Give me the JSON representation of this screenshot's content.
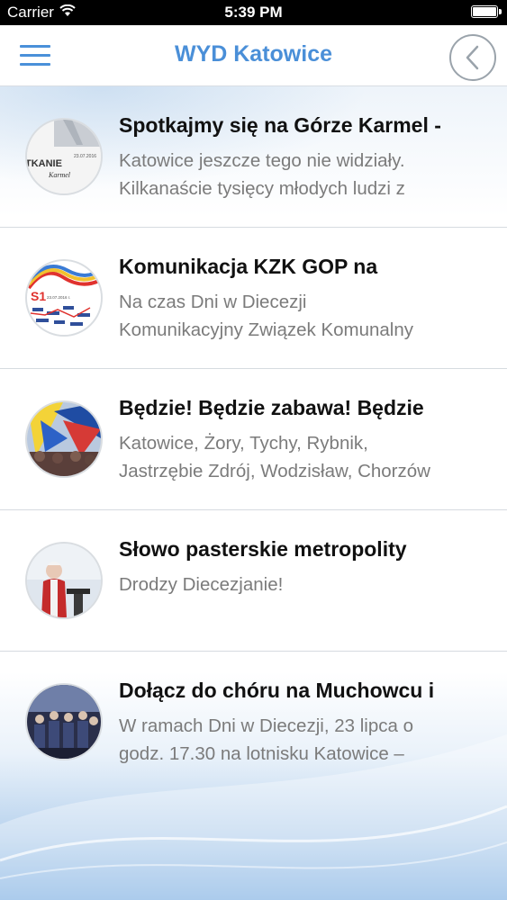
{
  "status_bar": {
    "carrier": "Carrier",
    "time": "5:39 PM"
  },
  "nav": {
    "title": "WYD Katowice"
  },
  "colors": {
    "accent": "#4a8fd8",
    "title_text": "#111111",
    "excerpt_text": "#7b7b7b"
  },
  "news": [
    {
      "title": "Spotkajmy się na Górze Karmel -",
      "excerpt": "Katowice jeszcze tego nie widziały.\nKilkanaście tysięcy młodych ludzi z",
      "thumb_text": "TKANIE",
      "thumb_sub": "Karmel",
      "thumb_date": "23.07.2016"
    },
    {
      "title": "Komunikacja KZK GOP na",
      "excerpt": "Na czas Dni w Diecezji\nKomunikacyjny Związek Komunalny",
      "thumb_text": "S1",
      "thumb_date": "23.07.2016 r."
    },
    {
      "title": "Będzie! Będzie zabawa! Będzie",
      "excerpt": "Katowice, Żory, Tychy, Rybnik,\nJastrzębie Zdrój, Wodzisław, Chorzów"
    },
    {
      "title": "Słowo pasterskie metropolity",
      "excerpt": "Drodzy Diecezjanie!"
    },
    {
      "title": "Dołącz do chóru na Muchowcu i",
      "excerpt": "W ramach Dni w Diecezji, 23 lipca o\ngodz. 17.30 na lotnisku Katowice –"
    }
  ]
}
